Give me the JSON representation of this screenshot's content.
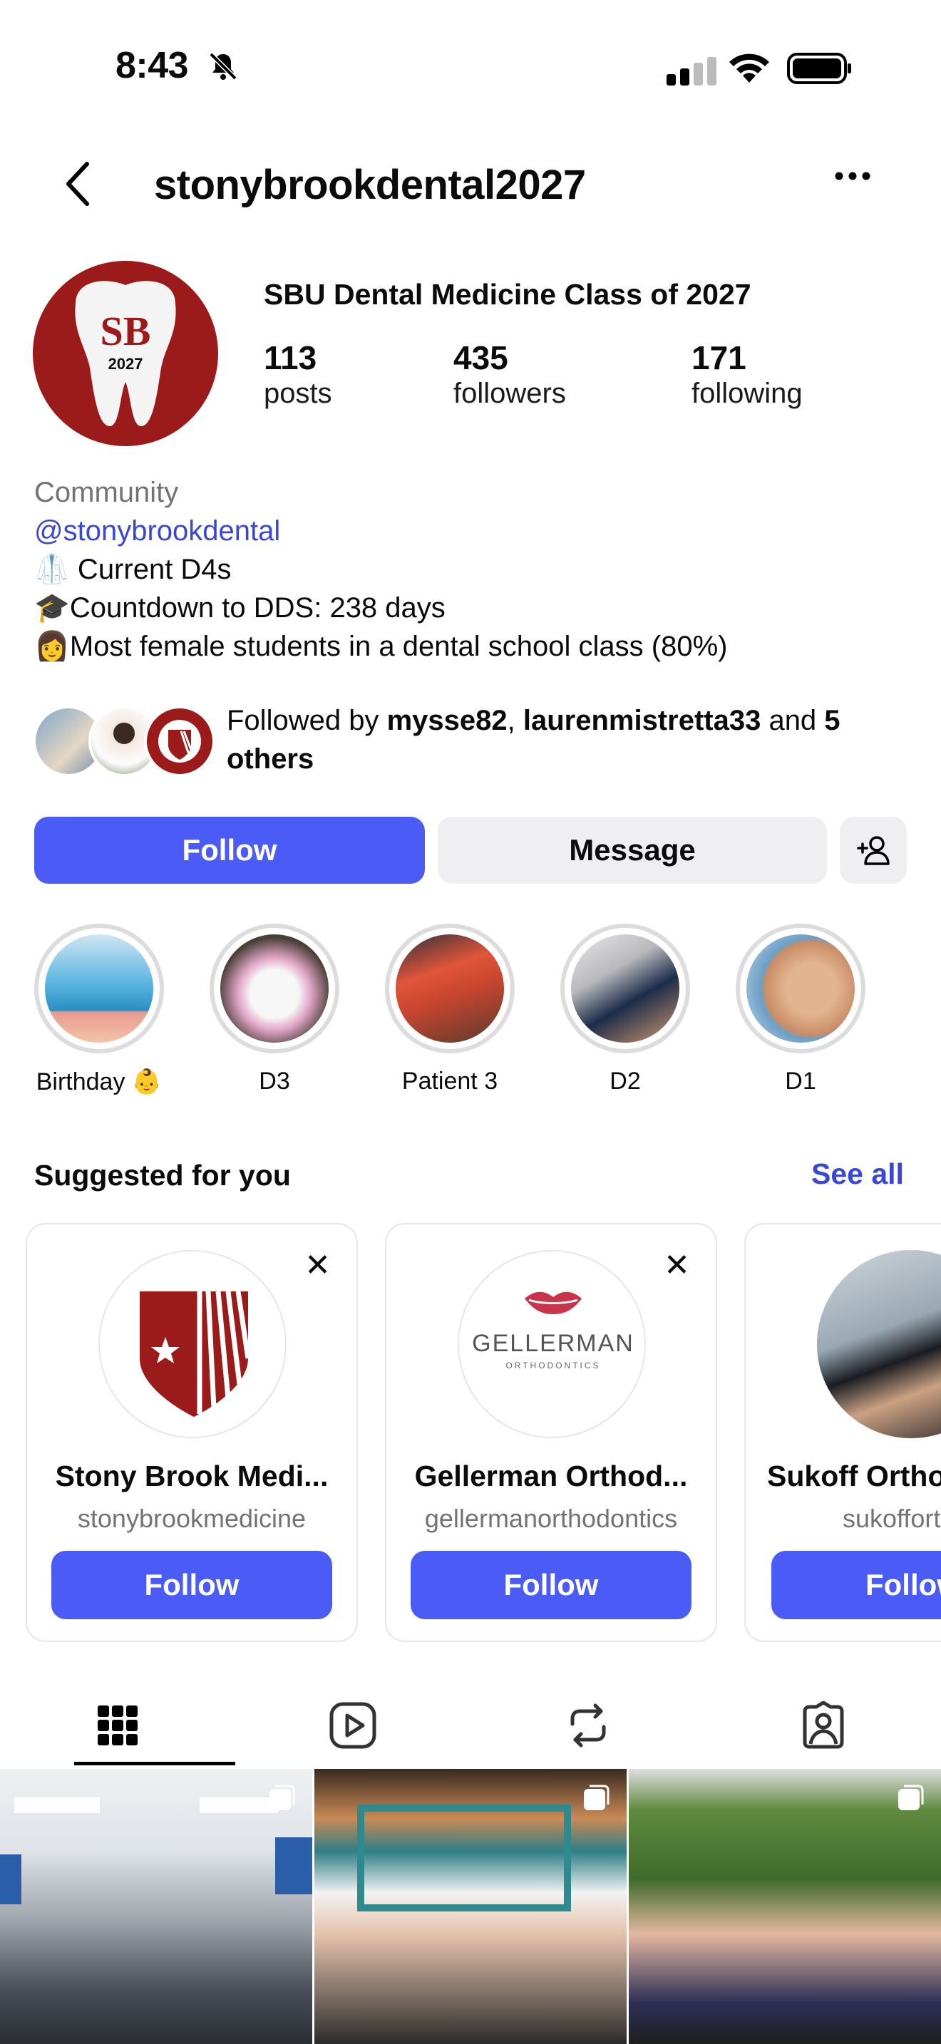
{
  "status_bar": {
    "time": "8:43"
  },
  "header": {
    "username": "stonybrookdental2027"
  },
  "profile": {
    "display_name": "SBU Dental Medicine Class of 2027",
    "avatar_text": {
      "top": "SB",
      "year": "2027"
    },
    "stats": [
      {
        "num": "113",
        "label": "posts"
      },
      {
        "num": "435",
        "label": "followers"
      },
      {
        "num": "171",
        "label": "following"
      }
    ],
    "bio": {
      "category": "Community",
      "handle": "@stonybrookdental",
      "lines": [
        {
          "emoji": "🥼",
          "text": " Current D4s"
        },
        {
          "emoji": "🎓",
          "text": "Countdown to DDS: 238 days"
        },
        {
          "emoji": "👩",
          "text": "Most female students in a dental school class (80%)"
        }
      ]
    },
    "followed_by": {
      "prefix": "Followed by ",
      "user1": "mysse82",
      "sep": ", ",
      "user2": "laurenmistretta33",
      "and": " and ",
      "others": "5 others"
    }
  },
  "actions": {
    "follow": "Follow",
    "message": "Message"
  },
  "highlights": [
    {
      "label": "Birthday 👶"
    },
    {
      "label": "D3"
    },
    {
      "label": "Patient 3"
    },
    {
      "label": "D2"
    },
    {
      "label": "D1"
    }
  ],
  "suggested": {
    "title": "Suggested for you",
    "see_all": "See all",
    "cards": [
      {
        "name": "Stony Brook Medi...",
        "handle": "stonybrookmedicine",
        "button": "Follow",
        "close": "✕"
      },
      {
        "name": "Gellerman Orthod...",
        "handle": "gellermanorthodontics",
        "button": "Follow",
        "close": "✕",
        "logo_text": "GELLERMAN",
        "logo_sub": "ORTHODONTICS"
      },
      {
        "name": "Sukoff Orthod...",
        "handle": "sukofforthodontics",
        "button": "Follow"
      }
    ]
  },
  "tabs": [
    "grid-icon",
    "reels-icon",
    "reposts-icon",
    "tagged-icon"
  ],
  "colors": {
    "accent": "#4a5cf5",
    "link": "#3a47d5",
    "brand_red": "#9b1b1b"
  }
}
